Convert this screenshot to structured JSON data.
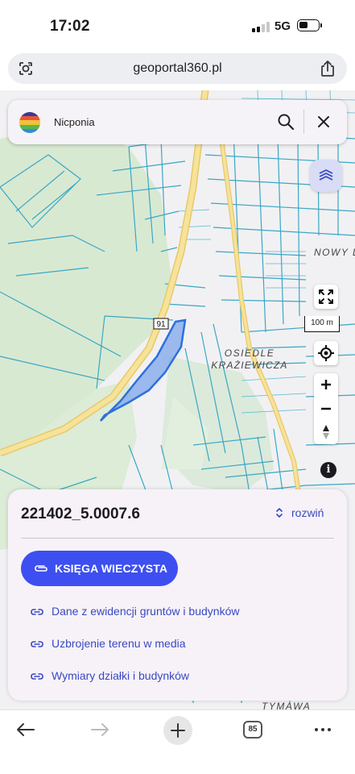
{
  "status_bar": {
    "time": "17:02",
    "network": "5G"
  },
  "browser": {
    "url": "geoportal360.pl",
    "tab_count": "85"
  },
  "search": {
    "query": "Nicponia"
  },
  "map": {
    "labels": {
      "road_number": "91",
      "district_1": "OSIEDLE",
      "district_2": "KRAŻIEWICZA",
      "area_right": "NOWY DW",
      "area_bottom": "TYMAWA"
    },
    "scale": "100 m"
  },
  "parcel_sheet": {
    "parcel_id": "221402_5.0007.6",
    "expand_label": "rozwiń",
    "primary_action": "KSIĘGA WIECZYSTA",
    "links": [
      "Dane z ewidencji gruntów i budynków",
      "Uzbrojenie terenu w media",
      "Wymiary działki i budynków"
    ]
  },
  "colors": {
    "accent": "#3d4ff0",
    "link": "#3a48c0",
    "parcel_line": "#3aa7c5",
    "forest": "#d9ead3",
    "road": "#f4dc8c"
  }
}
